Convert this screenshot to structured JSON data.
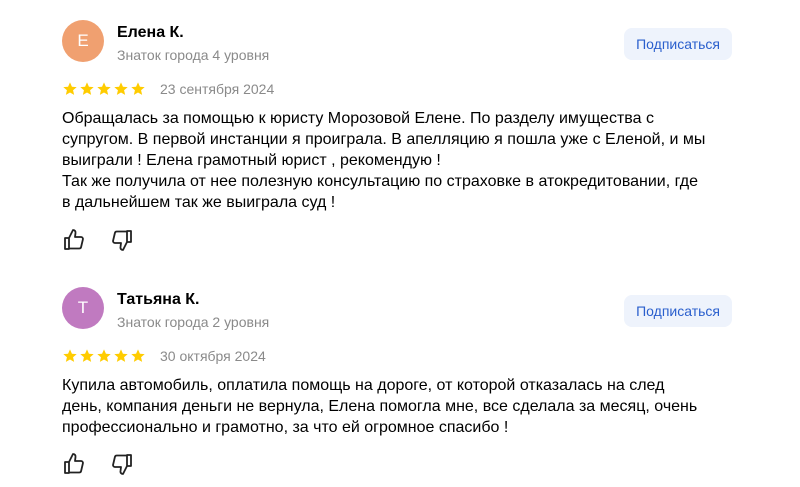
{
  "reviews": [
    {
      "avatar_letter": "Е",
      "avatar_color": "#f0a070",
      "author": "Елена К.",
      "level": "Знаток города 4 уровня",
      "subscribe_label": "Подписаться",
      "rating": 5,
      "date": "23 сентября 2024",
      "text": "Обращалась за помощью к юристу Морозовой Елене. По разделу имущества с\nсупругом. В первой инстанции я проиграла. В апелляцию я пошла уже с Еленой, и мы\nвыиграли ! Елена грамотный юрист , рекомендую !\nТак же получила от нее полезную консультацию по страховке в атокредитовании, где\nв дальнейшем так же выиграла суд !"
    },
    {
      "avatar_letter": "Т",
      "avatar_color": "#c07ac0",
      "author": "Татьяна К.",
      "level": "Знаток города 2 уровня",
      "subscribe_label": "Подписаться",
      "rating": 5,
      "date": "30 октября 2024",
      "text": "Купила автомобиль, оплатила помощь на дороге, от которой отказалась на след\nдень, компания деньги не вернула, Елена помогла мне, все сделала за месяц, очень\nпрофессионально и грамотно, за что ей огромное спасибо !"
    }
  ],
  "colors": {
    "star": "#ffcc00",
    "subscribe_bg": "#eef3fc",
    "subscribe_text": "#2a5fcd",
    "muted_text": "#8a8a8a"
  },
  "icons": {
    "like": "thumbs-up-icon",
    "dislike": "thumbs-down-icon",
    "star": "star-icon"
  }
}
